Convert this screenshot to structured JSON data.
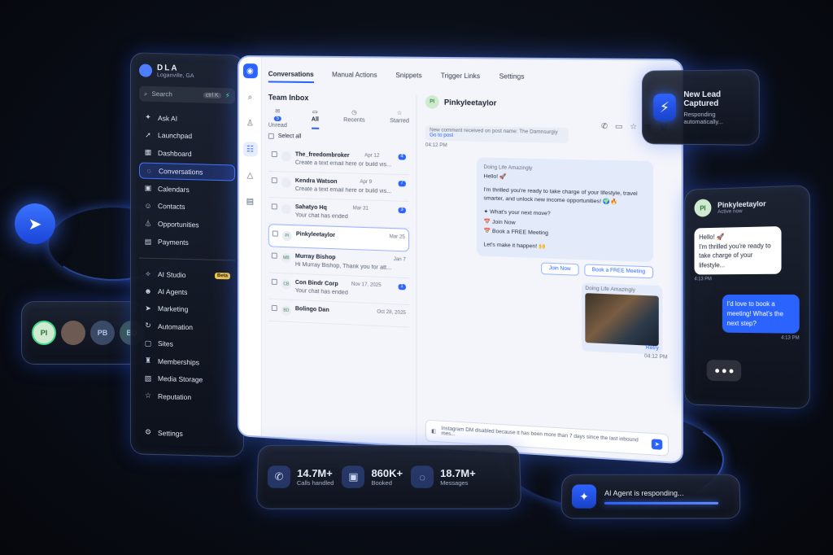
{
  "sidebar": {
    "brand_name": "DLA",
    "brand_location": "Loganville, GA",
    "search_placeholder": "Search",
    "search_kbd": "ctrl K",
    "items": [
      {
        "label": "Ask AI",
        "icon": "sparkle-icon"
      },
      {
        "label": "Launchpad",
        "icon": "rocket-icon"
      },
      {
        "label": "Dashboard",
        "icon": "grid-icon"
      },
      {
        "label": "Conversations",
        "icon": "chat-icon",
        "active": true
      },
      {
        "label": "Calendars",
        "icon": "calendar-icon"
      },
      {
        "label": "Contacts",
        "icon": "contacts-icon"
      },
      {
        "label": "Opportunities",
        "icon": "funnel-icon"
      },
      {
        "label": "Payments",
        "icon": "payments-icon"
      }
    ],
    "items2": [
      {
        "label": "AI Studio",
        "icon": "studio-icon",
        "badge": "Beta"
      },
      {
        "label": "AI Agents",
        "icon": "robot-icon"
      },
      {
        "label": "Marketing",
        "icon": "send-icon"
      },
      {
        "label": "Automation",
        "icon": "automation-icon"
      },
      {
        "label": "Sites",
        "icon": "sites-icon"
      },
      {
        "label": "Memberships",
        "icon": "memberships-icon"
      },
      {
        "label": "Media Storage",
        "icon": "image-icon"
      },
      {
        "label": "Reputation",
        "icon": "star-icon"
      }
    ],
    "settings_label": "Settings"
  },
  "main": {
    "tabs": [
      "Conversations",
      "Manual Actions",
      "Snippets",
      "Trigger Links",
      "Settings"
    ],
    "inbox_title": "Team Inbox",
    "filters": [
      {
        "label": "Unread",
        "badge": "5"
      },
      {
        "label": "All"
      },
      {
        "label": "Recents"
      },
      {
        "label": "Starred"
      }
    ],
    "select_all": "Select all",
    "conversations": [
      {
        "initials": "",
        "name": "The_freedombroker",
        "date": "Apr 12",
        "badge": "4",
        "preview": "Create a text email here or build vis..."
      },
      {
        "initials": "",
        "name": "Kendra Watson",
        "date": "Apr 9",
        "badge": "7",
        "preview": "Create a text email here or build vis..."
      },
      {
        "initials": "",
        "name": "Sahatyo Hq",
        "date": "Mar 31",
        "badge": "3",
        "preview": "Your chat has ended"
      },
      {
        "initials": "PI",
        "name": "Pinkyleetaylor",
        "date": "Mar 25",
        "badge": "",
        "preview": ""
      },
      {
        "initials": "MB",
        "name": "Murray Bishop",
        "date": "Jan 7",
        "badge": "",
        "preview": "Hi Murray Bishop, Thank you for att..."
      },
      {
        "initials": "CB",
        "name": "Con Bindr Corp",
        "date": "Nov 17, 2025",
        "badge": "1",
        "preview": "Your chat has ended"
      },
      {
        "initials": "BD",
        "name": "Bolingo Dan",
        "date": "Oct 28, 2025",
        "badge": "",
        "preview": ""
      }
    ],
    "chat": {
      "contact_initials": "PI",
      "contact_name": "Pinkyleetaylor",
      "system_note": "New comment received on post name: The Damnsurgiy",
      "system_link": "Go to post",
      "time1": "04:12 PM",
      "msg_source": "Doing Life Amazingly",
      "msg_lines": [
        "Hello! 🚀",
        "I'm thrilled you're ready to take charge of your lifestyle, travel smarter, and unlock new income opportunities! 🌍🔥",
        "✦ What's your next move?",
        "📅 Join Now",
        "📅 Book a FREE Meeting",
        "Let's make it happen! 🙌"
      ],
      "btn_join": "Join Now",
      "btn_book": "Book a FREE Meeting",
      "img_source": "Doing Life Amazingly",
      "retry": "Retry",
      "time2": "04:12 PM",
      "composer_text": "Instagram DM disabled because it has been more than 7 days since the last inbound mes..."
    }
  },
  "lead_card": {
    "title": "New Lead Captured",
    "subtitle": "Responding automatically..."
  },
  "phone": {
    "initials": "PI",
    "name": "Pinkyleetaylor",
    "status": "Active now",
    "msg_in": "Hello! 🚀\nI'm thrilled you're ready to take charge of your lifestyle...",
    "time_in": "4:13 PM",
    "msg_out": "I'd love to book a meeting! What's the next step?",
    "time_out": "4:13 PM"
  },
  "avatars": [
    {
      "initials": "PI",
      "color": "#cfead0",
      "text": "#2d6d33"
    },
    {
      "initials": "",
      "color": "#6d5a52",
      "text": "#fff"
    },
    {
      "initials": "PB",
      "color": "#3a4a66",
      "text": "#aec3ea"
    },
    {
      "initials": "BD",
      "color": "#3d5650",
      "text": "#aee0c8"
    }
  ],
  "stats": [
    {
      "value": "14.7M+",
      "label": "Calls handled",
      "icon": "phone-icon"
    },
    {
      "value": "860K+",
      "label": "Booked",
      "icon": "calendar-icon"
    },
    {
      "value": "18.7M+",
      "label": "Messages",
      "icon": "chat-icon"
    }
  ],
  "agent": {
    "text": "AI Agent is responding..."
  },
  "colors": {
    "accent": "#2b63ff",
    "bg": "#0a0e17"
  }
}
